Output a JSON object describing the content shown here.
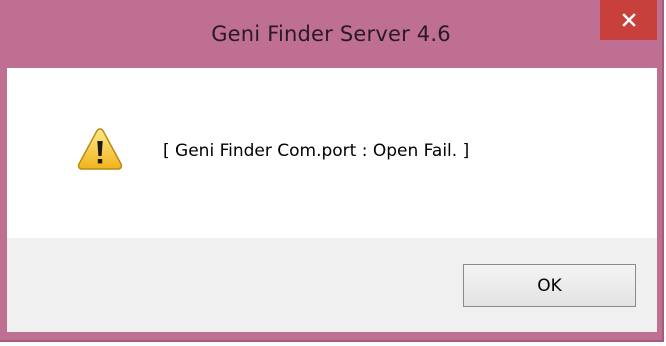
{
  "window": {
    "title": "Geni Finder Server 4.6",
    "frame_color": "#bf6f92",
    "close_button_color": "#c8403c"
  },
  "dialog": {
    "icon": "warning-icon",
    "message": "[ Geni Finder Com.port : Open Fail. ]"
  },
  "buttons": {
    "ok_label": "OK"
  }
}
